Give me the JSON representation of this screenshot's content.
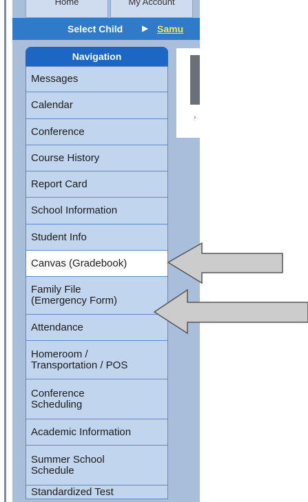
{
  "tabs": [
    "Home",
    "My Account"
  ],
  "child_bar": {
    "select_label": "Select Child",
    "arrow": "▶",
    "child_name": "Samu"
  },
  "navigation": {
    "title": "Navigation",
    "items": [
      "Messages",
      "Calendar",
      "Conference",
      "Course History",
      "Report Card",
      "School Information",
      "Student Info",
      "Canvas (Gradebook)",
      "Family File\n(Emergency Form)",
      "Attendance",
      "Homeroom /\nTransportation / POS",
      "Conference\nScheduling",
      "Academic Information",
      "Summer School\nSchedule",
      "Standardized Test"
    ],
    "active_item": "Canvas (Gradebook)"
  },
  "content_toggle": "›",
  "colors": {
    "nav_header": "#1c66c4",
    "nav_item": "#c2d5ee",
    "child_bar": "#2f7ac9",
    "child_name": "#f6e94c",
    "frame": "#a9bedb"
  },
  "icons": [
    "right-arrow-icon",
    "pointer-arrow-icon"
  ]
}
